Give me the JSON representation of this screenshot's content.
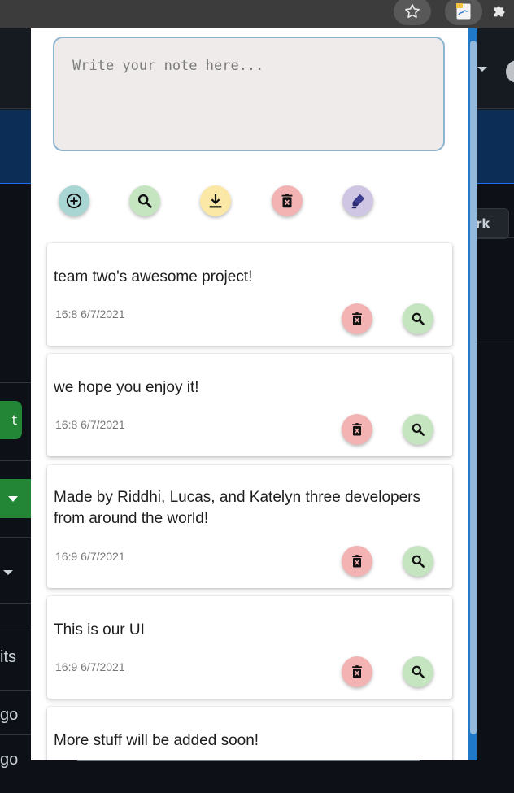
{
  "colors": {
    "add_bg": "#a9d6d2",
    "search_bg": "#c5e5c1",
    "download_bg": "#fbe8a6",
    "delete_bg": "#f4b3b3",
    "highlight_bg": "#cfc6e4",
    "popup_border": "#8db4cf",
    "github_green": "#238636"
  },
  "background_page": {
    "work_button_label": "rk",
    "side_labels": [
      "its",
      "go",
      "go"
    ],
    "green_button_label": "t"
  },
  "note_input": {
    "value": "",
    "placeholder": "Write your note here..."
  },
  "toolbar": {
    "buttons": [
      {
        "name": "add",
        "icon": "add-circle-icon"
      },
      {
        "name": "search",
        "icon": "magnifier-icon"
      },
      {
        "name": "download",
        "icon": "download-icon"
      },
      {
        "name": "delete-all",
        "icon": "trash-icon"
      },
      {
        "name": "highlight",
        "icon": "highlighter-icon"
      }
    ]
  },
  "notes": [
    {
      "text": "team two's awesome project!",
      "timestamp": "16:8 6/7/2021"
    },
    {
      "text": "we hope you enjoy it!",
      "timestamp": "16:8 6/7/2021"
    },
    {
      "text": "Made by Riddhi, Lucas, and Katelyn three developers from around the world!",
      "timestamp": "16:9 6/7/2021"
    },
    {
      "text": "This is our UI",
      "timestamp": "16:9 6/7/2021"
    },
    {
      "text": "More stuff will be added soon!",
      "timestamp": ""
    }
  ]
}
